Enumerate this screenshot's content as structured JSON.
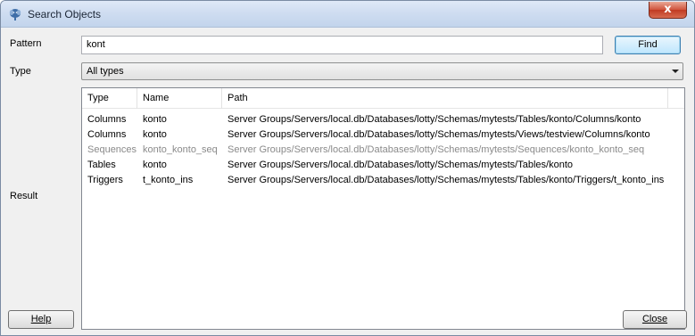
{
  "window": {
    "title": "Search Objects",
    "close_glyph": "x"
  },
  "icons": {
    "title": "elephant-icon",
    "close": "close-icon",
    "dropdown": "chevron-down-icon"
  },
  "pattern": {
    "label": "Pattern",
    "value": "kont",
    "find_label": "Find"
  },
  "type": {
    "label": "Type",
    "selected": "All types"
  },
  "result": {
    "label": "Result",
    "columns": [
      "Type",
      "Name",
      "Path"
    ],
    "rows": [
      {
        "type": "Columns",
        "name": "konto",
        "path": "Server Groups/Servers/local.db/Databases/lotty/Schemas/mytests/Tables/konto/Columns/konto",
        "dimmed": false
      },
      {
        "type": "Columns",
        "name": "konto",
        "path": "Server Groups/Servers/local.db/Databases/lotty/Schemas/mytests/Views/testview/Columns/konto",
        "dimmed": false
      },
      {
        "type": "Sequences",
        "name": "konto_konto_seq",
        "path": "Server Groups/Servers/local.db/Databases/lotty/Schemas/mytests/Sequences/konto_konto_seq",
        "dimmed": true
      },
      {
        "type": "Tables",
        "name": "konto",
        "path": "Server Groups/Servers/local.db/Databases/lotty/Schemas/mytests/Tables/konto",
        "dimmed": false
      },
      {
        "type": "Triggers",
        "name": "t_konto_ins",
        "path": "Server Groups/Servers/local.db/Databases/lotty/Schemas/mytests/Tables/konto/Triggers/t_konto_ins",
        "dimmed": false
      }
    ]
  },
  "footer": {
    "help_label": "Help",
    "close_label": "Close"
  }
}
